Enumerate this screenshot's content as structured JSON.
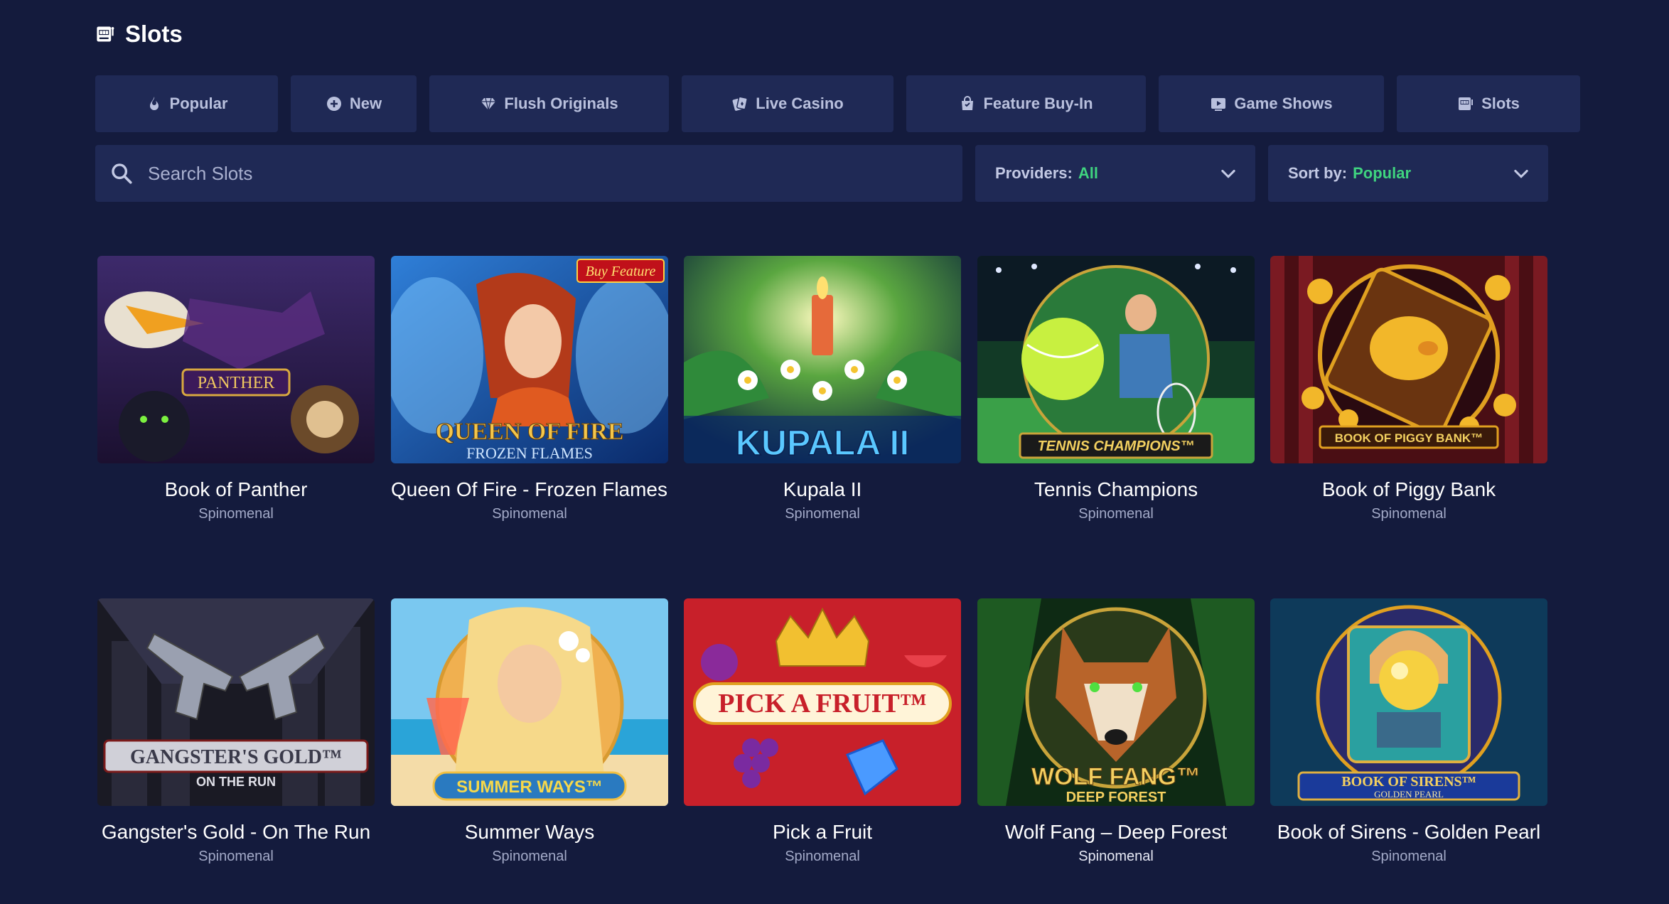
{
  "page": {
    "title": "Slots"
  },
  "tabs": [
    {
      "label": "Popular",
      "icon": "fire-icon"
    },
    {
      "label": "New",
      "icon": "plus-circle-icon"
    },
    {
      "label": "Flush Originals",
      "icon": "diamond-icon"
    },
    {
      "label": "Live Casino",
      "icon": "cards-icon"
    },
    {
      "label": "Feature Buy-In",
      "icon": "shopping-bag-icon"
    },
    {
      "label": "Game Shows",
      "icon": "play-screen-icon"
    },
    {
      "label": "Slots",
      "icon": "slot-machine-icon"
    }
  ],
  "search": {
    "placeholder": "Search Slots",
    "value": ""
  },
  "filters": {
    "providers": {
      "label": "Providers:",
      "value": "All"
    },
    "sort": {
      "label": "Sort by:",
      "value": "Popular"
    }
  },
  "games": [
    {
      "name": "Book of Panther",
      "provider": "Spinomenal",
      "thumb_title": "PANTHER"
    },
    {
      "name": "Queen Of Fire - Frozen Flames",
      "provider": "Spinomenal",
      "thumb_title": "QUEEN OF FIRE",
      "thumb_subtitle": "FROZEN FLAMES",
      "badge": "Buy Feature"
    },
    {
      "name": "Kupala II",
      "provider": "Spinomenal",
      "thumb_title": "KUPALA II"
    },
    {
      "name": "Tennis Champions",
      "provider": "Spinomenal",
      "thumb_title": "TENNIS CHAMPIONS™"
    },
    {
      "name": "Book of Piggy Bank",
      "provider": "Spinomenal",
      "thumb_title": "BOOK OF PIGGY BANK™"
    },
    {
      "name": "Gangster's Gold - On The Run",
      "provider": "Spinomenal",
      "thumb_title": "GANGSTER'S GOLD™",
      "thumb_subtitle": "ON THE RUN"
    },
    {
      "name": "Summer Ways",
      "provider": "Spinomenal",
      "thumb_title": "SUMMER WAYS™"
    },
    {
      "name": "Pick a Fruit",
      "provider": "Spinomenal",
      "thumb_title": "PICK A FRUIT™"
    },
    {
      "name": "Wolf Fang – Deep Forest",
      "provider": "Spinomenal",
      "thumb_title": "WOLF FANG™",
      "thumb_subtitle": "DEEP FOREST"
    },
    {
      "name": "Book of Sirens - Golden Pearl",
      "provider": "Spinomenal",
      "thumb_title": "BOOK OF SIRENS™",
      "thumb_subtitle": "GOLDEN PEARL"
    }
  ],
  "colors": {
    "background": "#141b3d",
    "surface": "#1f2955",
    "accent": "#3fd37f",
    "muted_text": "#a3aac8"
  }
}
